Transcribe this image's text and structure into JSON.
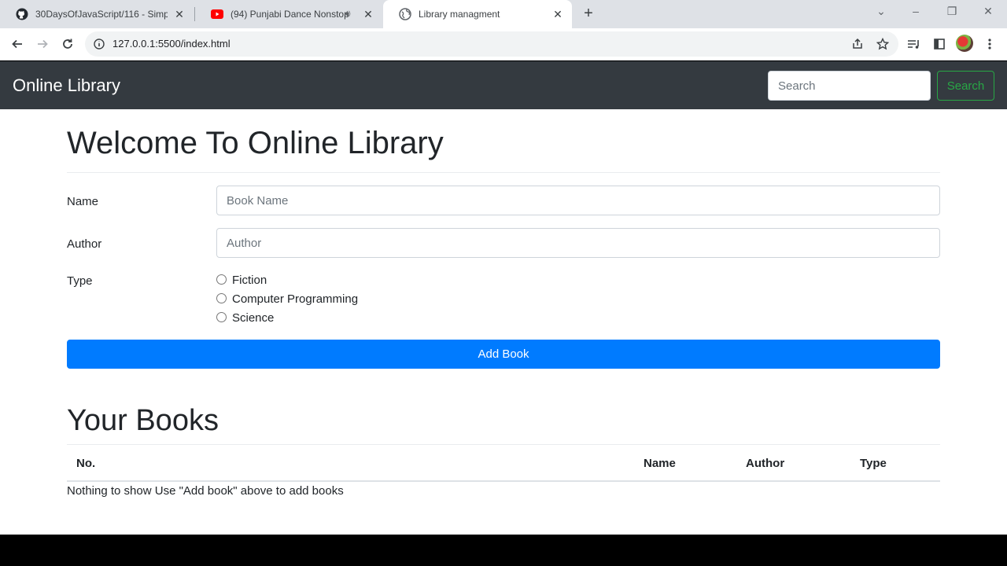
{
  "browser": {
    "tabs": [
      {
        "title": "30DaysOfJavaScript/116 - Simpl",
        "icon": "github-icon"
      },
      {
        "title": "(94) Punjabi Dance Nonstop",
        "icon": "youtube-icon"
      },
      {
        "title": "Library managment",
        "icon": "globe-icon"
      }
    ],
    "url": "127.0.0.1:5500/index.html"
  },
  "navbar": {
    "brand": "Online Library",
    "search_placeholder": "Search",
    "search_button": "Search"
  },
  "form": {
    "heading": "Welcome To Online Library",
    "name_label": "Name",
    "name_placeholder": "Book Name",
    "author_label": "Author",
    "author_placeholder": "Author",
    "type_label": "Type",
    "types": [
      "Fiction",
      "Computer Programming",
      "Science"
    ],
    "submit_label": "Add Book"
  },
  "books": {
    "heading": "Your Books",
    "columns": [
      "No.",
      "Name",
      "Author",
      "Type"
    ],
    "empty_message": "Nothing to show Use \"Add book\" above to add books"
  },
  "colors": {
    "navbar_bg": "#343a40",
    "primary": "#007bff",
    "success": "#28a745"
  }
}
